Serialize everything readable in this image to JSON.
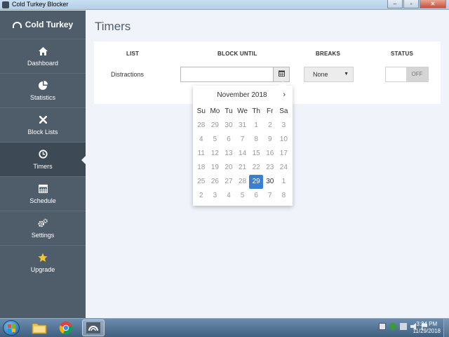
{
  "window": {
    "title": "Cold Turkey Blocker",
    "controls": [
      "–",
      "▫",
      "✕"
    ]
  },
  "sidebar": {
    "brand": "Cold Turkey",
    "items": [
      {
        "label": "Dashboard",
        "icon": "home-icon"
      },
      {
        "label": "Statistics",
        "icon": "pie-chart-icon"
      },
      {
        "label": "Block Lists",
        "icon": "x-icon"
      },
      {
        "label": "Timers",
        "icon": "clock-icon",
        "active": true
      },
      {
        "label": "Schedule",
        "icon": "calendar-icon"
      },
      {
        "label": "Settings",
        "icon": "gears-icon"
      },
      {
        "label": "Upgrade",
        "icon": "star-icon"
      }
    ]
  },
  "main": {
    "title": "Timers",
    "columns": {
      "list": "LIST",
      "block_until": "BLOCK UNTIL",
      "breaks": "BREAKS",
      "status": "STATUS"
    },
    "row": {
      "list": "Distractions",
      "block_until_value": "",
      "breaks": "None",
      "status": "OFF"
    }
  },
  "datepicker": {
    "month": "November 2018",
    "next": "›",
    "weekdays": [
      "Su",
      "Mo",
      "Tu",
      "We",
      "Th",
      "Fr",
      "Sa"
    ],
    "weeks": [
      [
        "28",
        "29",
        "30",
        "31",
        "1",
        "2",
        "3"
      ],
      [
        "4",
        "5",
        "6",
        "7",
        "8",
        "9",
        "10"
      ],
      [
        "11",
        "12",
        "13",
        "14",
        "15",
        "16",
        "17"
      ],
      [
        "18",
        "19",
        "20",
        "21",
        "22",
        "23",
        "24"
      ],
      [
        "25",
        "26",
        "27",
        "28",
        "29",
        "30",
        "1"
      ],
      [
        "2",
        "3",
        "4",
        "5",
        "6",
        "7",
        "8"
      ]
    ],
    "selected": "29",
    "current_after_selected": [
      "30"
    ]
  },
  "taskbar": {
    "time": "3:24 PM",
    "date": "11/29/2018"
  },
  "colors": {
    "sidebar": "#4f5d6b",
    "sidebar_active": "#3d4955",
    "accent": "#3a7fd1",
    "background": "#f0f3fa"
  }
}
